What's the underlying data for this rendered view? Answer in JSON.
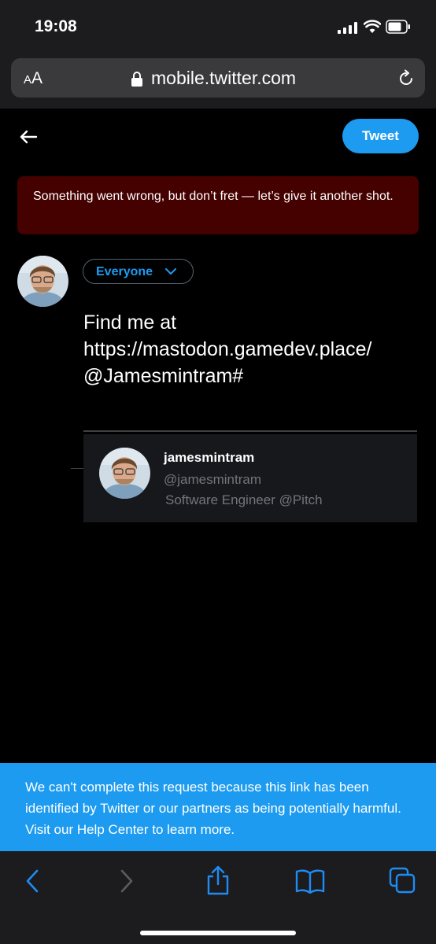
{
  "status": {
    "time": "19:08"
  },
  "browser": {
    "aa_small": "A",
    "aa_large": "A",
    "url": "mobile.twitter.com"
  },
  "header": {
    "tweet_label": "Tweet"
  },
  "error": {
    "message": "Something went wrong, but don’t fret — let’s give it another shot."
  },
  "composer": {
    "audience_label": "Everyone",
    "text_lines": [
      "Find me at",
      "https://mastodon.gamedev.place/",
      "@Jamesmintram#"
    ]
  },
  "suggestion": {
    "name": "jamesmintram",
    "handle": "@jamesmintram",
    "bio": "Software Engineer @Pitch"
  },
  "notice": {
    "message": "We can't complete this request because this link has been identified by Twitter or our partners as being potentially harmful. Visit our Help Center to learn more."
  },
  "colors": {
    "accent": "#1d9bf0",
    "error_bg": "#450000",
    "chrome_bg": "#1c1c1e"
  },
  "icons": {
    "back": "arrow-left-icon",
    "lock": "lock-icon",
    "reload": "reload-icon",
    "chevron": "chevron-down-icon",
    "nav_back": "chevron-left-icon",
    "nav_forward": "chevron-right-icon",
    "share": "share-icon",
    "bookmarks": "book-icon",
    "tabs": "tabs-icon"
  }
}
